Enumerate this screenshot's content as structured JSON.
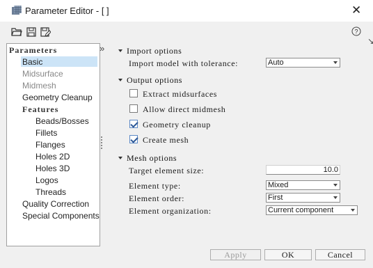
{
  "window": {
    "title": "Parameter Editor - [ ]",
    "close_label": "✕",
    "help_label": "?"
  },
  "tree": {
    "header_parameters": "Parameters",
    "basic": "Basic",
    "midsurface": "Midsurface",
    "midmesh": "Midmesh",
    "geometry_cleanup": "Geometry Cleanup",
    "header_features": "Features",
    "beads_bosses": "Beads/Bosses",
    "fillets": "Fillets",
    "flanges": "Flanges",
    "holes_2d": "Holes 2D",
    "holes_3d": "Holes 3D",
    "logos": "Logos",
    "threads": "Threads",
    "quality_correction": "Quality Correction",
    "special_components": "Special Components",
    "collapse_glyph": "»"
  },
  "import_options": {
    "title": "Import options",
    "tolerance_label": "Import model with tolerance:",
    "tolerance_value": "Auto"
  },
  "output_options": {
    "title": "Output options",
    "extract_midsurfaces": {
      "label": "Extract midsurfaces",
      "checked": false
    },
    "allow_direct_midmesh": {
      "label": "Allow direct midmesh",
      "checked": false
    },
    "geometry_cleanup": {
      "label": "Geometry cleanup",
      "checked": true
    },
    "create_mesh": {
      "label": "Create mesh",
      "checked": true
    }
  },
  "mesh_options": {
    "title": "Mesh options",
    "target_size_label": "Target element size:",
    "target_size_value": "10.0",
    "element_type_label": "Element type:",
    "element_type_value": "Mixed",
    "element_order_label": "Element order:",
    "element_order_value": "First",
    "element_org_label": "Element organization:",
    "element_org_value": "Current component"
  },
  "buttons": {
    "apply": "Apply",
    "ok": "OK",
    "cancel": "Cancel"
  }
}
